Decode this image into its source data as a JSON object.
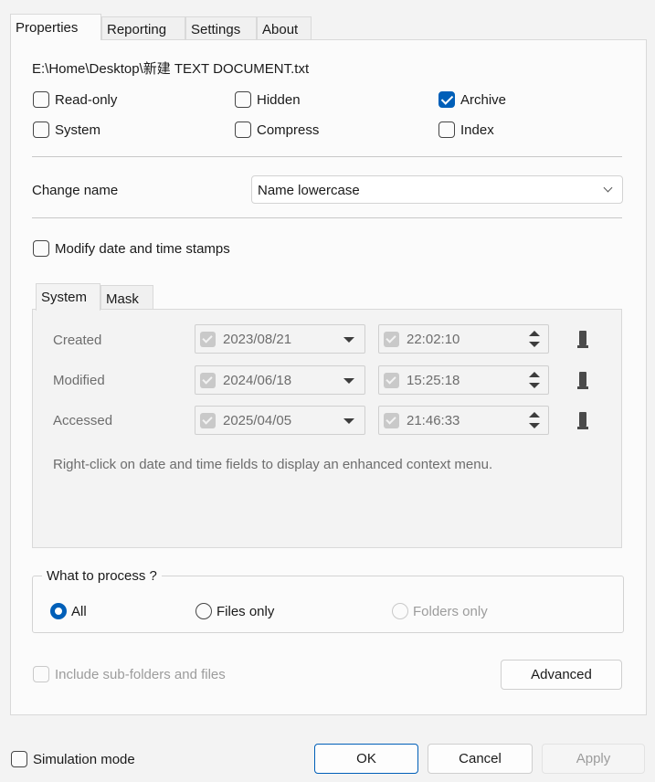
{
  "tabs": [
    "Properties",
    "Reporting",
    "Settings",
    "About"
  ],
  "file_path": "E:\\Home\\Desktop\\新建 TEXT DOCUMENT.txt",
  "attributes": {
    "read_only": {
      "label": "Read-only",
      "checked": false
    },
    "hidden": {
      "label": "Hidden",
      "checked": false
    },
    "archive": {
      "label": "Archive",
      "checked": true
    },
    "system": {
      "label": "System",
      "checked": false
    },
    "compress": {
      "label": "Compress",
      "checked": false
    },
    "index": {
      "label": "Index",
      "checked": false
    }
  },
  "change_name": {
    "label": "Change name",
    "value": "Name lowercase"
  },
  "modify_dates": {
    "label": "Modify date and time stamps",
    "checked": false
  },
  "subtabs": [
    "System",
    "Mask"
  ],
  "dates": {
    "created": {
      "label": "Created",
      "date": "2023/08/21",
      "time": "22:02:10"
    },
    "modified": {
      "label": "Modified",
      "date": "2024/06/18",
      "time": "15:25:18"
    },
    "accessed": {
      "label": "Accessed",
      "date": "2025/04/05",
      "time": "21:46:33"
    }
  },
  "hint": "Right-click on date and time fields to display an enhanced context menu.",
  "process": {
    "legend": "What to process ?",
    "all": "All",
    "files_only": "Files only",
    "folders_only": "Folders only",
    "selected": "All"
  },
  "include_sub": {
    "label": "Include sub-folders and files",
    "checked": false
  },
  "buttons": {
    "advanced": "Advanced",
    "ok": "OK",
    "cancel": "Cancel",
    "apply": "Apply"
  },
  "simulation": {
    "label": "Simulation mode",
    "checked": false
  },
  "colors": {
    "accent": "#005fb8"
  }
}
